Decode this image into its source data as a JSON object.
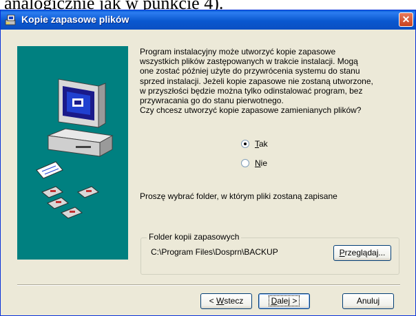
{
  "doc": {
    "text": "analogicznie jak w punkcie 4)."
  },
  "window": {
    "title": "Kopie zapasowe plików",
    "close_symbol": "✕"
  },
  "body": {
    "lines": [
      "Program instalacyjny może utworzyć kopie zapasowe",
      "wszystkich plików zastępowanych w trakcie instalacji. Mogą",
      "one zostać później użyte do przywrócenia systemu do stanu",
      "sprzed instalacji. Jeżeli kopie zapasowe nie zostaną utworzone,",
      "w przyszłości będzie można tylko odinstalować program, bez",
      "przywracania go do stanu pierwotnego."
    ],
    "question": "Czy chcesz utworzyć kopie zapasowe zamienianych plików?"
  },
  "options": [
    {
      "accel": "T",
      "rest": "ak",
      "selected": true
    },
    {
      "accel": "N",
      "rest": "ie",
      "selected": false
    }
  ],
  "choose_folder_text": "Proszę wybrać folder, w którym pliki zostaną zapisane",
  "folder": {
    "group_label": "Folder kopii zapasowych",
    "path": "C:\\Program Files\\Dosprn\\BACKUP"
  },
  "buttons": {
    "browse": {
      "accel": "P",
      "rest": "rzeglądaj..."
    },
    "back": {
      "prefix": "< ",
      "accel": "W",
      "rest": "stecz"
    },
    "next": {
      "accel": "D",
      "rest": "alej >"
    },
    "cancel": "Anuluj"
  },
  "colors": {
    "titlebar": "#0a58d0",
    "side_panel": "#008080",
    "dialog_bg": "#ece9d8"
  }
}
